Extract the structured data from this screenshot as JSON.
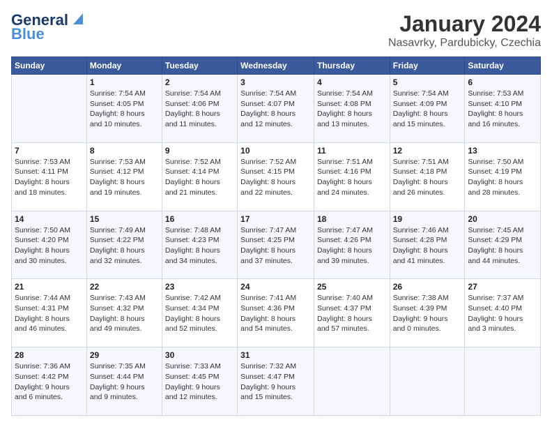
{
  "logo": {
    "text_general": "General",
    "text_blue": "Blue"
  },
  "title": "January 2024",
  "subtitle": "Nasavrky, Pardubicky, Czechia",
  "weekdays": [
    "Sunday",
    "Monday",
    "Tuesday",
    "Wednesday",
    "Thursday",
    "Friday",
    "Saturday"
  ],
  "weeks": [
    [
      {
        "num": "",
        "info": ""
      },
      {
        "num": "1",
        "info": "Sunrise: 7:54 AM\nSunset: 4:05 PM\nDaylight: 8 hours\nand 10 minutes."
      },
      {
        "num": "2",
        "info": "Sunrise: 7:54 AM\nSunset: 4:06 PM\nDaylight: 8 hours\nand 11 minutes."
      },
      {
        "num": "3",
        "info": "Sunrise: 7:54 AM\nSunset: 4:07 PM\nDaylight: 8 hours\nand 12 minutes."
      },
      {
        "num": "4",
        "info": "Sunrise: 7:54 AM\nSunset: 4:08 PM\nDaylight: 8 hours\nand 13 minutes."
      },
      {
        "num": "5",
        "info": "Sunrise: 7:54 AM\nSunset: 4:09 PM\nDaylight: 8 hours\nand 15 minutes."
      },
      {
        "num": "6",
        "info": "Sunrise: 7:53 AM\nSunset: 4:10 PM\nDaylight: 8 hours\nand 16 minutes."
      }
    ],
    [
      {
        "num": "7",
        "info": "Sunrise: 7:53 AM\nSunset: 4:11 PM\nDaylight: 8 hours\nand 18 minutes."
      },
      {
        "num": "8",
        "info": "Sunrise: 7:53 AM\nSunset: 4:12 PM\nDaylight: 8 hours\nand 19 minutes."
      },
      {
        "num": "9",
        "info": "Sunrise: 7:52 AM\nSunset: 4:14 PM\nDaylight: 8 hours\nand 21 minutes."
      },
      {
        "num": "10",
        "info": "Sunrise: 7:52 AM\nSunset: 4:15 PM\nDaylight: 8 hours\nand 22 minutes."
      },
      {
        "num": "11",
        "info": "Sunrise: 7:51 AM\nSunset: 4:16 PM\nDaylight: 8 hours\nand 24 minutes."
      },
      {
        "num": "12",
        "info": "Sunrise: 7:51 AM\nSunset: 4:18 PM\nDaylight: 8 hours\nand 26 minutes."
      },
      {
        "num": "13",
        "info": "Sunrise: 7:50 AM\nSunset: 4:19 PM\nDaylight: 8 hours\nand 28 minutes."
      }
    ],
    [
      {
        "num": "14",
        "info": "Sunrise: 7:50 AM\nSunset: 4:20 PM\nDaylight: 8 hours\nand 30 minutes."
      },
      {
        "num": "15",
        "info": "Sunrise: 7:49 AM\nSunset: 4:22 PM\nDaylight: 8 hours\nand 32 minutes."
      },
      {
        "num": "16",
        "info": "Sunrise: 7:48 AM\nSunset: 4:23 PM\nDaylight: 8 hours\nand 34 minutes."
      },
      {
        "num": "17",
        "info": "Sunrise: 7:47 AM\nSunset: 4:25 PM\nDaylight: 8 hours\nand 37 minutes."
      },
      {
        "num": "18",
        "info": "Sunrise: 7:47 AM\nSunset: 4:26 PM\nDaylight: 8 hours\nand 39 minutes."
      },
      {
        "num": "19",
        "info": "Sunrise: 7:46 AM\nSunset: 4:28 PM\nDaylight: 8 hours\nand 41 minutes."
      },
      {
        "num": "20",
        "info": "Sunrise: 7:45 AM\nSunset: 4:29 PM\nDaylight: 8 hours\nand 44 minutes."
      }
    ],
    [
      {
        "num": "21",
        "info": "Sunrise: 7:44 AM\nSunset: 4:31 PM\nDaylight: 8 hours\nand 46 minutes."
      },
      {
        "num": "22",
        "info": "Sunrise: 7:43 AM\nSunset: 4:32 PM\nDaylight: 8 hours\nand 49 minutes."
      },
      {
        "num": "23",
        "info": "Sunrise: 7:42 AM\nSunset: 4:34 PM\nDaylight: 8 hours\nand 52 minutes."
      },
      {
        "num": "24",
        "info": "Sunrise: 7:41 AM\nSunset: 4:36 PM\nDaylight: 8 hours\nand 54 minutes."
      },
      {
        "num": "25",
        "info": "Sunrise: 7:40 AM\nSunset: 4:37 PM\nDaylight: 8 hours\nand 57 minutes."
      },
      {
        "num": "26",
        "info": "Sunrise: 7:38 AM\nSunset: 4:39 PM\nDaylight: 9 hours\nand 0 minutes."
      },
      {
        "num": "27",
        "info": "Sunrise: 7:37 AM\nSunset: 4:40 PM\nDaylight: 9 hours\nand 3 minutes."
      }
    ],
    [
      {
        "num": "28",
        "info": "Sunrise: 7:36 AM\nSunset: 4:42 PM\nDaylight: 9 hours\nand 6 minutes."
      },
      {
        "num": "29",
        "info": "Sunrise: 7:35 AM\nSunset: 4:44 PM\nDaylight: 9 hours\nand 9 minutes."
      },
      {
        "num": "30",
        "info": "Sunrise: 7:33 AM\nSunset: 4:45 PM\nDaylight: 9 hours\nand 12 minutes."
      },
      {
        "num": "31",
        "info": "Sunrise: 7:32 AM\nSunset: 4:47 PM\nDaylight: 9 hours\nand 15 minutes."
      },
      {
        "num": "",
        "info": ""
      },
      {
        "num": "",
        "info": ""
      },
      {
        "num": "",
        "info": ""
      }
    ]
  ]
}
